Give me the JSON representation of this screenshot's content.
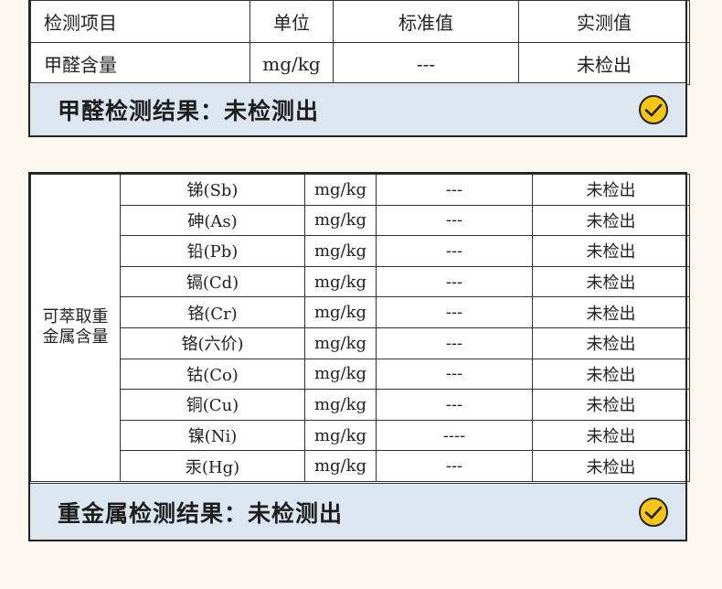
{
  "formaldehyde": {
    "headers": [
      "检测项目",
      "单位",
      "标准值",
      "实测值"
    ],
    "row": [
      "甲醛含量",
      "mg/kg",
      "---",
      "未检出"
    ],
    "result": "甲醛检测结果：未检测出"
  },
  "heavy_metals": {
    "category": "可萃取重金属含量",
    "rows": [
      [
        "锑(Sb)",
        "mg/kg",
        "---",
        "未检出"
      ],
      [
        "砷(As)",
        "mg/kg",
        "---",
        "未检出"
      ],
      [
        "铅(Pb)",
        "mg/kg",
        "---",
        "未检出"
      ],
      [
        "镉(Cd)",
        "mg/kg",
        "---",
        "未检出"
      ],
      [
        "铬(Cr)",
        "mg/kg",
        "---",
        "未检出"
      ],
      [
        "铬(六价)",
        "mg/kg",
        "---",
        "未检出"
      ],
      [
        "钴(Co)",
        "mg/kg",
        "---",
        "未检出"
      ],
      [
        "铜(Cu)",
        "mg/kg",
        "---",
        "未检出"
      ],
      [
        "镍(Ni)",
        "mg/kg",
        "----",
        "未检出"
      ],
      [
        "汞(Hg)",
        "mg/kg",
        "---",
        "未检出"
      ]
    ],
    "result": "重金属检测结果：未检测出"
  },
  "colors": {
    "result_bar": "#dbe6f1",
    "check_fill": "#f5c518",
    "background": "#fcf8f0"
  },
  "icons": {
    "result_check": "check-circle-icon"
  }
}
